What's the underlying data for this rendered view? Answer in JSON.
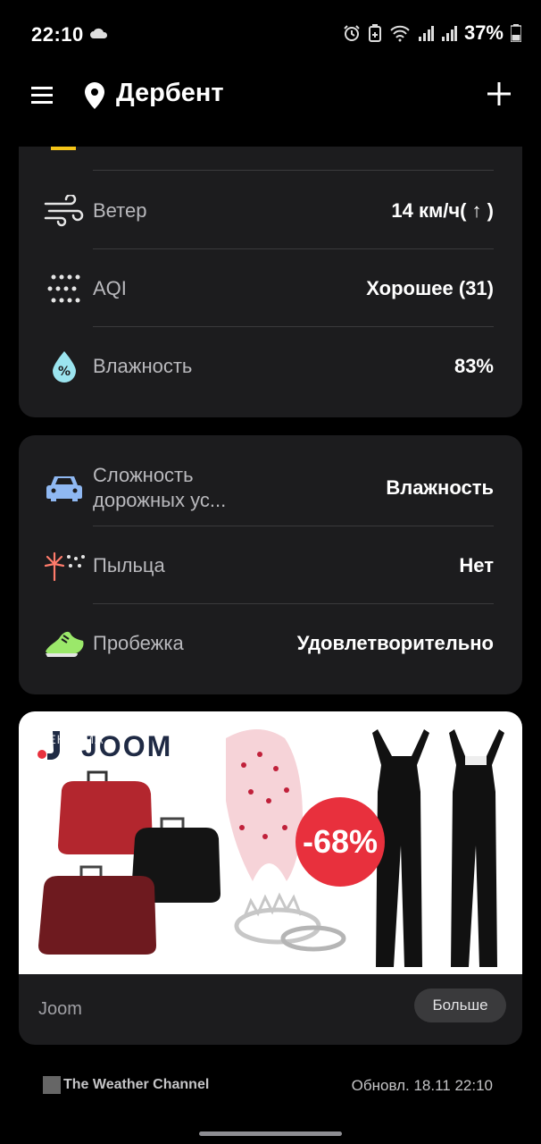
{
  "status_bar": {
    "time": "22:10",
    "battery": "37%"
  },
  "header": {
    "city": "Дербент"
  },
  "weather_details": [
    {
      "icon": "wind-icon",
      "label": "Ветер",
      "value": "14 км/ч( ↑ )"
    },
    {
      "icon": "aqi-dots-icon",
      "label": "AQI",
      "value": "Хорошее (31)"
    },
    {
      "icon": "humidity-drop-icon",
      "label": "Влажность",
      "value": "83%"
    }
  ],
  "activity_details": [
    {
      "icon": "car-icon",
      "label": "Сложность\nдорожных ус...",
      "value": "Влажность"
    },
    {
      "icon": "pollen-icon",
      "label": "Пыльца",
      "value": "Нет"
    },
    {
      "icon": "running-shoe-icon",
      "label": "Пробежка",
      "value": "Удовлетворительно"
    }
  ],
  "ad": {
    "label": "РЕКЛАМА",
    "brand": "JOOM",
    "discount": "-68%",
    "advertiser": "Joom",
    "more_button": "Больше"
  },
  "footer": {
    "provider": "The Weather Channel",
    "updated": "Обновл. 18.11 22:10"
  },
  "colors": {
    "card_bg": "#1c1c1e",
    "accent_yellow": "#f5c518",
    "discount_red": "#e8303d"
  }
}
